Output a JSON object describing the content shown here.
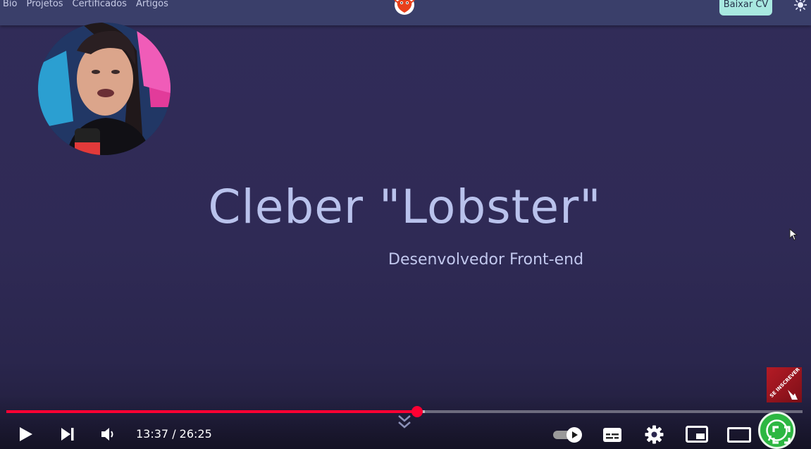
{
  "nav": {
    "links": [
      "Bio",
      "Projetos",
      "Certificados",
      "Artigos"
    ],
    "cv_button": "Baixar CV",
    "logo_icon": "lobster-logo-icon",
    "theme_icon": "sun-icon"
  },
  "hero": {
    "name": "Cleber \"Lobster\"",
    "role": "Desenvolvedor Front-end"
  },
  "overlay": {
    "subscribe_text": "SE INSCREVER"
  },
  "player": {
    "current_time": "13:37",
    "duration": "26:25",
    "time_text": "13:37 / 26:25",
    "progress_fraction": 0.5155,
    "buffered_fraction": 0.526,
    "autoplay_on": true,
    "icons": {
      "play": "play-icon",
      "next": "next-icon",
      "volume": "volume-icon",
      "autoplay": "autoplay-toggle-icon",
      "subtitles": "subtitles-icon",
      "settings": "gear-icon",
      "miniplayer": "miniplayer-icon",
      "theater": "theater-mode-icon",
      "fullscreen": "fullscreen-icon"
    }
  },
  "colors": {
    "background": "#2f2b56",
    "nav_background": "#3a3f6a",
    "hero_text": "#b9c2ec",
    "cv_button": "#a8e8e0",
    "progress_played": "#ff0033",
    "whatsapp": "#2db742"
  }
}
